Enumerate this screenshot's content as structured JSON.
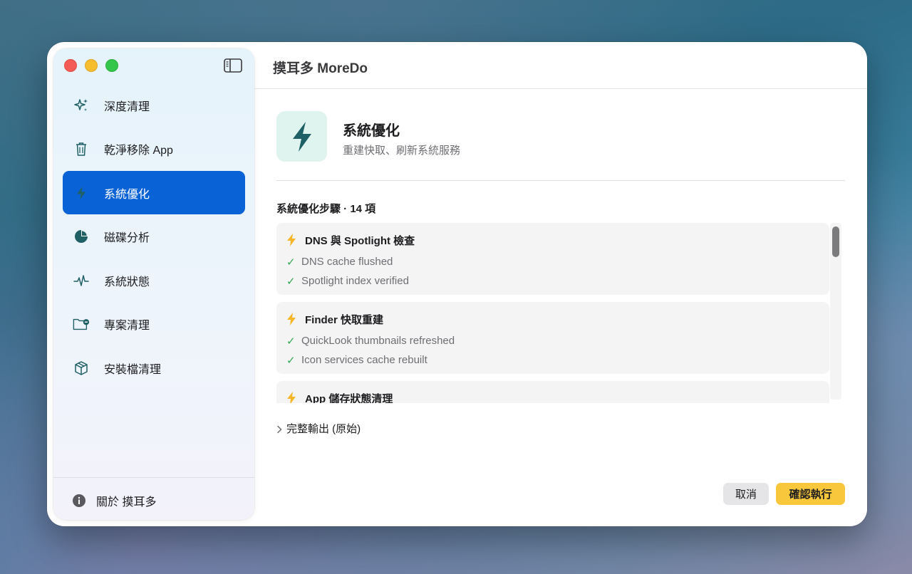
{
  "window": {
    "title": "摸耳多 MoreDo"
  },
  "sidebar": {
    "toggle_icon": "sidebar-toggle-icon",
    "items": [
      {
        "label": "深度清理",
        "icon": "sparkles-icon",
        "active": false
      },
      {
        "label": "乾淨移除 App",
        "icon": "trash-icon",
        "active": false
      },
      {
        "label": "系統優化",
        "icon": "bolt-icon",
        "active": true
      },
      {
        "label": "磁碟分析",
        "icon": "pie-chart-icon",
        "active": false
      },
      {
        "label": "系統狀態",
        "icon": "pulse-icon",
        "active": false
      },
      {
        "label": "專案清理",
        "icon": "folder-minus-icon",
        "active": false
      },
      {
        "label": "安裝檔清理",
        "icon": "box-icon",
        "active": false
      }
    ],
    "about_label": "關於 摸耳多"
  },
  "hero": {
    "title": "系統優化",
    "subtitle": "重建快取、刷新系統服務"
  },
  "steps": {
    "heading": "系統優化步驟 · 14 項",
    "items": [
      {
        "title": "DNS 與 Spotlight 檢查",
        "lines": [
          "DNS cache flushed",
          "Spotlight index verified"
        ]
      },
      {
        "title": "Finder 快取重建",
        "lines": [
          "QuickLook thumbnails refreshed",
          "Icon services cache rebuilt"
        ]
      },
      {
        "title": "App 儲存狀態清理",
        "lines": []
      }
    ]
  },
  "disclosure_label": "完整輸出 (原始)",
  "buttons": {
    "cancel": "取消",
    "confirm": "確認執行"
  },
  "colors": {
    "accent": "#0a63d6",
    "confirm": "#f9c73c",
    "bolt": "#f6b62a",
    "hero_icon": "#1f5f66"
  }
}
